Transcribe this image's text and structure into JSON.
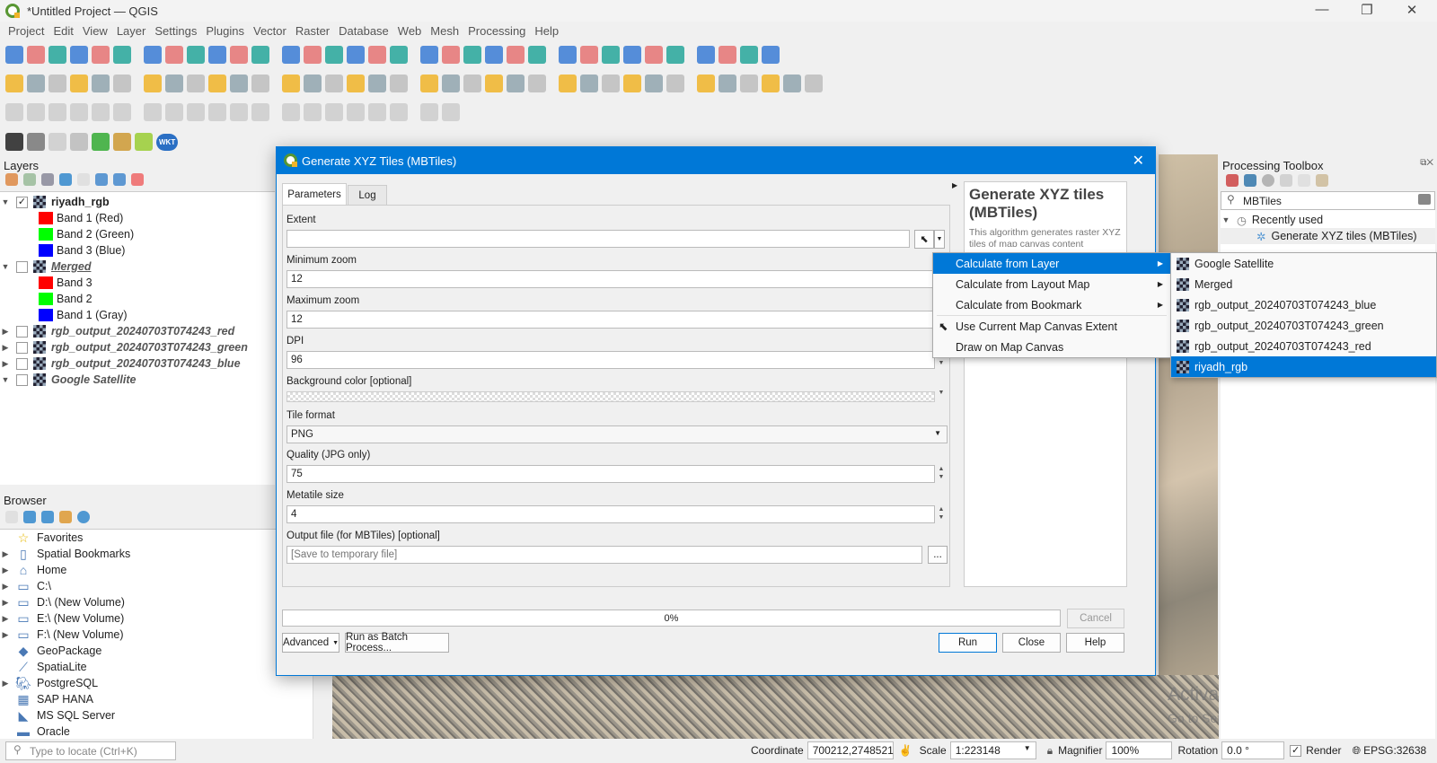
{
  "window": {
    "title": "*Untitled Project — QGIS",
    "controls": [
      "—",
      "❐",
      "✕"
    ]
  },
  "menu": [
    "Project",
    "Edit",
    "View",
    "Layer",
    "Settings",
    "Plugins",
    "Vector",
    "Raster",
    "Database",
    "Web",
    "Mesh",
    "Processing",
    "Help"
  ],
  "toolbars": {
    "row1_count": 34,
    "row2_count": 36,
    "row3_count": 20,
    "row4_labels": [
      "WKT"
    ]
  },
  "colors": {
    "accent": "#0078d7",
    "band_red": "#ff0000",
    "band_green": "#00ff00",
    "band_blue": "#0000ff"
  },
  "layers": {
    "title": "Layers",
    "items": [
      {
        "name": "riyadh_rgb",
        "checked": true,
        "expanded": true,
        "bands": [
          "Band 1 (Red)",
          "Band 2 (Green)",
          "Band 3 (Blue)"
        ]
      },
      {
        "name": "Merged",
        "checked": false,
        "expanded": true,
        "bands": [
          "Band 3",
          "Band 2",
          "Band 1 (Gray)"
        ]
      },
      {
        "name": "rgb_output_20240703T074243_red",
        "checked": false,
        "expanded": false
      },
      {
        "name": "rgb_output_20240703T074243_green",
        "checked": false,
        "expanded": false
      },
      {
        "name": "rgb_output_20240703T074243_blue",
        "checked": false,
        "expanded": false
      },
      {
        "name": "Google Satellite",
        "checked": false,
        "expanded": true
      }
    ]
  },
  "browser": {
    "title": "Browser",
    "items": [
      {
        "label": "Favorites",
        "icon": "star-icon",
        "expandable": false
      },
      {
        "label": "Spatial Bookmarks",
        "icon": "bookmark-icon",
        "expandable": true
      },
      {
        "label": "Home",
        "icon": "home-icon",
        "expandable": true
      },
      {
        "label": "C:\\",
        "icon": "folder-icon",
        "expandable": true
      },
      {
        "label": "D:\\ (New Volume)",
        "icon": "folder-icon",
        "expandable": true
      },
      {
        "label": "E:\\ (New Volume)",
        "icon": "folder-icon",
        "expandable": true
      },
      {
        "label": "F:\\ (New Volume)",
        "icon": "folder-icon",
        "expandable": true
      },
      {
        "label": "GeoPackage",
        "icon": "geopackage-icon",
        "expandable": false
      },
      {
        "label": "SpatiaLite",
        "icon": "spatialite-icon",
        "expandable": false
      },
      {
        "label": "PostgreSQL",
        "icon": "postgresql-icon",
        "expandable": true
      },
      {
        "label": "SAP HANA",
        "icon": "sap-hana-icon",
        "expandable": false
      },
      {
        "label": "MS SQL Server",
        "icon": "mssql-icon",
        "expandable": false
      },
      {
        "label": "Oracle",
        "icon": "oracle-icon",
        "expandable": false
      }
    ]
  },
  "locator": {
    "placeholder": "Type to locate (Ctrl+K)"
  },
  "dialog": {
    "title": "Generate XYZ Tiles (MBTiles)",
    "tabs": [
      "Parameters",
      "Log"
    ],
    "params": {
      "extent_label": "Extent",
      "extent_value": "",
      "min_zoom_label": "Minimum zoom",
      "min_zoom": "12",
      "max_zoom_label": "Maximum zoom",
      "max_zoom": "12",
      "dpi_label": "DPI",
      "dpi": "96",
      "bg_label": "Background color [optional]",
      "format_label": "Tile format",
      "format": "PNG",
      "quality_label": "Quality (JPG only)",
      "quality": "75",
      "metatile_label": "Metatile size",
      "metatile": "4",
      "output_label": "Output file (for MBTiles) [optional]",
      "output_placeholder": "[Save to temporary file]",
      "browse": "..."
    },
    "help": {
      "title": "Generate XYZ tiles (MBTiles)",
      "text": "This algorithm generates raster XYZ tiles of map canvas content"
    },
    "progress": {
      "value": 0,
      "label": "0%"
    },
    "buttons": {
      "cancel": "Cancel",
      "advanced": "Advanced",
      "batch": "Run as Batch Process...",
      "run": "Run",
      "close": "Close",
      "help": "Help"
    }
  },
  "extent_menu": {
    "items": [
      {
        "label": "Calculate from Layer",
        "submenu": true,
        "selected": true
      },
      {
        "label": "Calculate from Layout Map",
        "submenu": true
      },
      {
        "label": "Calculate from Bookmark",
        "submenu": true
      },
      {
        "label": "Use Current Map Canvas Extent",
        "icon": "map-canvas-extent-icon"
      },
      {
        "label": "Draw on Map Canvas"
      }
    ]
  },
  "layer_submenu": {
    "items": [
      "Google Satellite",
      "Merged",
      "rgb_output_20240703T074243_blue",
      "rgb_output_20240703T074243_green",
      "rgb_output_20240703T074243_red",
      "riyadh_rgb"
    ],
    "selected": "riyadh_rgb"
  },
  "toolbox": {
    "title": "Processing Toolbox",
    "search": "MBTiles",
    "group": "Recently used",
    "item": "Generate XYZ tiles (MBTiles)"
  },
  "watermark": {
    "line1": "Activate Windows",
    "line2": "Go to Settings to activate Windows."
  },
  "status": {
    "coordinate_label": "Coordinate",
    "coordinate": "700212,2748521",
    "scale_label": "Scale",
    "scale": "1:223148",
    "magnifier_label": "Magnifier",
    "magnifier": "100%",
    "rotation_label": "Rotation",
    "rotation": "0.0 °",
    "render_label": "Render",
    "render_checked": true,
    "crs": "EPSG:32638"
  }
}
